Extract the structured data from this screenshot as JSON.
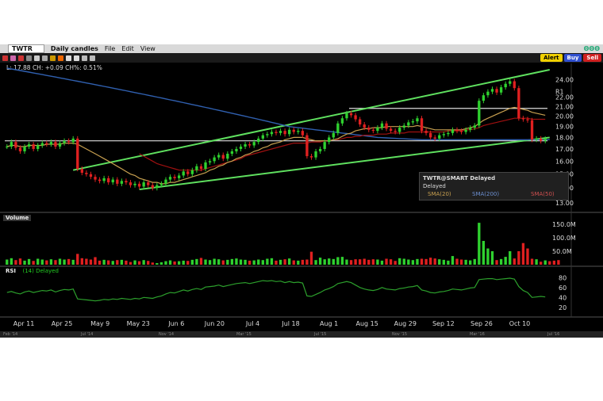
{
  "toolbar": {
    "symbol": "TWTR",
    "timeframe": "Daily candles",
    "menu": [
      "File",
      "Edit",
      "View"
    ],
    "alert": "Alert",
    "buy": "Buy",
    "sell": "Sell",
    "right_label": "ΘΘΘ"
  },
  "info_line": "L: 17.88 CH: +0.09 CH%: 0.51%",
  "legend": {
    "title": "TWTR@SMART Delayed",
    "status": "Delayed",
    "sma20": "SMA(20)",
    "sma200": "SMA(200)",
    "sma50": "SMA(50)",
    "colors": {
      "sma20": "#c8a050",
      "sma200": "#3060b0",
      "sma50": "#a01010"
    }
  },
  "panels": {
    "volume": "Volume",
    "rsi": "RSI",
    "rsi_series": "(14) Delayed"
  },
  "r1_label": "R1",
  "chart_data": {
    "type": "candlestick",
    "price_axis": {
      "ticks": [
        "24.00",
        "22.00",
        "21.00",
        "20.00",
        "19.00",
        "18.00",
        "17.00",
        "16.00",
        "15.00",
        "14.00",
        "13.00"
      ],
      "ylim": [
        12.6,
        25.4
      ],
      "scale": "log"
    },
    "volume_axis": {
      "ticks": [
        "150.0M",
        "100.0M",
        "50.0M"
      ],
      "ylim": [
        0,
        170
      ]
    },
    "rsi_axis": {
      "ticks": [
        "80",
        "60",
        "40",
        "20"
      ],
      "ylim": [
        10,
        95
      ]
    },
    "x_ticks": [
      "Apr 11",
      "Apr 25",
      "May 9",
      "May 23",
      "Jun 6",
      "Jun 20",
      "Jul 4",
      "Jul 18",
      "Aug 1",
      "Aug 15",
      "Aug 29",
      "Sep 12",
      "Sep 26",
      "Oct 10"
    ],
    "overview_ticks": [
      "Feb '14",
      "Jul '14",
      "Nov '14",
      "Mar '15",
      "Jul '15",
      "Nov '15",
      "Mar '16",
      "Jul '16"
    ],
    "closes": [
      17.2,
      17.6,
      17.1,
      16.8,
      17.2,
      17.4,
      17.0,
      17.3,
      17.5,
      17.4,
      17.6,
      17.2,
      17.5,
      17.7,
      17.6,
      17.9,
      15.4,
      15.1,
      15.0,
      14.8,
      14.6,
      14.5,
      14.7,
      14.4,
      14.6,
      14.3,
      14.5,
      14.4,
      14.2,
      14.3,
      14.1,
      14.4,
      14.2,
      14.0,
      14.2,
      14.3,
      14.6,
      14.8,
      14.7,
      14.9,
      15.2,
      15.0,
      15.3,
      15.6,
      15.4,
      15.9,
      16.0,
      16.3,
      16.5,
      16.2,
      16.6,
      16.8,
      17.0,
      17.2,
      17.4,
      17.3,
      17.6,
      17.9,
      18.2,
      18.3,
      18.5,
      18.4,
      18.6,
      18.3,
      18.7,
      18.5,
      18.6,
      18.2,
      16.4,
      16.3,
      16.8,
      17.0,
      17.6,
      18.0,
      18.4,
      19.3,
      19.8,
      20.3,
      20.1,
      19.7,
      19.2,
      18.9,
      18.7,
      18.6,
      18.9,
      19.3,
      18.8,
      18.6,
      18.5,
      18.9,
      19.1,
      19.4,
      19.5,
      19.8,
      18.6,
      18.4,
      18.0,
      17.9,
      18.2,
      18.3,
      18.4,
      18.7,
      18.6,
      18.5,
      18.7,
      18.9,
      19.1,
      21.6,
      22.2,
      22.6,
      22.9,
      22.5,
      23.1,
      23.5,
      23.8,
      23.0,
      19.8,
      19.7,
      19.6,
      17.8,
      17.9,
      17.7,
      17.88
    ],
    "volume": [
      19,
      24,
      17,
      23,
      15,
      21,
      14,
      22,
      19,
      16,
      20,
      17,
      22,
      19,
      21,
      18,
      40,
      24,
      22,
      19,
      28,
      15,
      18,
      16,
      14,
      17,
      18,
      15,
      10,
      16,
      13,
      17,
      14,
      8,
      6,
      9,
      13,
      16,
      12,
      13,
      15,
      14,
      18,
      21,
      25,
      19,
      17,
      22,
      20,
      16,
      18,
      21,
      23,
      19,
      18,
      15,
      16,
      19,
      17,
      22,
      24,
      15,
      18,
      20,
      23,
      16,
      15,
      18,
      19,
      48,
      17,
      26,
      20,
      23,
      21,
      28,
      29,
      19,
      17,
      20,
      20,
      22,
      18,
      20,
      19,
      15,
      22,
      20,
      14,
      24,
      22,
      19,
      17,
      21,
      22,
      21,
      26,
      23,
      20,
      18,
      15,
      32,
      22,
      19,
      18,
      16,
      21,
      155,
      88,
      60,
      50,
      17,
      21,
      29,
      50,
      23,
      50,
      80,
      60,
      22,
      20,
      11,
      16,
      13,
      15,
      17
    ],
    "rsi": [
      50,
      52,
      49,
      47,
      51,
      53,
      50,
      52,
      54,
      53,
      55,
      51,
      54,
      56,
      55,
      57,
      37,
      36,
      35,
      34,
      33,
      34,
      36,
      35,
      37,
      36,
      38,
      37,
      36,
      38,
      37,
      40,
      39,
      38,
      41,
      43,
      47,
      50,
      49,
      52,
      55,
      53,
      56,
      58,
      56,
      61,
      62,
      63,
      65,
      62,
      64,
      66,
      68,
      69,
      70,
      68,
      70,
      72,
      74,
      73,
      74,
      72,
      73,
      70,
      72,
      70,
      71,
      69,
      43,
      42,
      46,
      50,
      55,
      58,
      62,
      68,
      70,
      72,
      70,
      65,
      60,
      57,
      55,
      54,
      56,
      60,
      57,
      56,
      55,
      58,
      59,
      61,
      62,
      64,
      55,
      53,
      50,
      49,
      51,
      52,
      54,
      57,
      56,
      55,
      57,
      59,
      60,
      76,
      77,
      78,
      78,
      76,
      77,
      78,
      79,
      77,
      62,
      54,
      50,
      40,
      41,
      42,
      41
    ],
    "sma20": [
      17.2,
      17.3,
      17.3,
      17.2,
      17.2,
      17.3,
      17.3,
      17.3,
      17.3,
      17.4,
      17.4,
      17.4,
      17.4,
      17.5,
      17.5,
      17.5,
      17.4,
      17.2,
      17.0,
      16.8,
      16.6,
      16.4,
      16.2,
      16.0,
      15.8,
      15.6,
      15.4,
      15.2,
      15.0,
      14.9,
      14.7,
      14.6,
      14.5,
      14.4,
      14.4,
      14.3,
      14.3,
      14.4,
      14.4,
      14.5,
      14.6,
      14.7,
      14.8,
      14.9,
      15.0,
      15.1,
      15.3,
      15.4,
      15.6,
      15.7,
      15.9,
      16.0,
      16.2,
      16.3,
      16.5,
      16.6,
      16.8,
      16.9,
      17.1,
      17.2,
      17.4,
      17.5,
      17.6,
      17.8,
      17.9,
      18.0,
      18.0,
      18.0,
      17.9,
      17.8,
      17.7,
      17.7,
      17.7,
      17.7,
      17.8,
      17.9,
      18.1,
      18.3,
      18.4,
      18.6,
      18.7,
      18.8,
      18.8,
      18.9,
      18.9,
      18.9,
      19.0,
      19.0,
      19.0,
      19.0,
      19.0,
      19.0,
      19.0,
      19.1,
      19.0,
      18.9,
      18.8,
      18.7,
      18.7,
      18.7,
      18.7,
      18.7,
      18.7,
      18.7,
      18.8,
      18.9,
      19.0,
      19.3,
      19.6,
      19.8,
      20.0,
      20.2,
      20.4,
      20.6,
      20.8,
      20.9,
      20.8,
      20.7,
      20.6,
      20.4,
      20.3,
      20.2,
      20.1
    ],
    "sma50": [
      null,
      null,
      null,
      null,
      null,
      null,
      null,
      null,
      null,
      null,
      null,
      null,
      null,
      null,
      null,
      null,
      null,
      null,
      null,
      null,
      null,
      null,
      null,
      null,
      null,
      null,
      null,
      null,
      null,
      null,
      16.6,
      16.4,
      16.2,
      16.0,
      15.8,
      15.7,
      15.6,
      15.5,
      15.4,
      15.3,
      15.3,
      15.3,
      15.3,
      15.3,
      15.3,
      15.4,
      15.5,
      15.6,
      15.7,
      15.8,
      15.9,
      16.0,
      16.1,
      16.2,
      16.4,
      16.5,
      16.6,
      16.7,
      16.8,
      16.9,
      17.0,
      17.1,
      17.2,
      17.3,
      17.4,
      17.5,
      17.5,
      17.5,
      17.5,
      17.6,
      17.6,
      17.6,
      17.7,
      17.7,
      17.8,
      17.8,
      17.9,
      18.0,
      18.0,
      18.1,
      18.1,
      18.2,
      18.2,
      18.2,
      18.3,
      18.3,
      18.3,
      18.4,
      18.4,
      18.4,
      18.4,
      18.5,
      18.5,
      18.5,
      18.5,
      18.5,
      18.5,
      18.5,
      18.5,
      18.5,
      18.6,
      18.6,
      18.6,
      18.6,
      18.7,
      18.7,
      18.8,
      18.9,
      19.1,
      19.2,
      19.3,
      19.4,
      19.5,
      19.6,
      19.7,
      19.8,
      19.8,
      19.8,
      19.8,
      19.7,
      19.7,
      19.7,
      19.7
    ],
    "sma200": [
      25.4,
      25.3,
      25.2,
      25.1,
      25.0,
      24.9,
      24.8,
      24.7,
      24.6,
      24.5,
      24.4,
      24.3,
      24.2,
      24.1,
      24.0,
      23.9,
      23.8,
      23.7,
      23.6,
      23.5,
      23.4,
      23.3,
      23.2,
      23.1,
      23.0,
      22.9,
      22.8,
      22.7,
      22.6,
      22.5,
      22.4,
      22.3,
      22.2,
      22.1,
      22.0,
      21.9,
      21.8,
      21.7,
      21.6,
      21.5,
      21.4,
      21.3,
      21.2,
      21.1,
      21.0,
      20.9,
      20.8,
      20.7,
      20.6,
      20.5,
      20.4,
      20.3,
      20.2,
      20.1,
      20.0,
      19.9,
      19.8,
      19.7,
      19.6,
      19.5,
      19.4,
      19.3,
      19.2,
      19.1,
      19.0,
      18.95,
      18.9,
      18.85,
      18.8,
      18.75,
      18.7,
      18.65,
      18.6,
      18.55,
      18.5,
      18.45,
      18.4,
      18.35,
      18.3,
      18.25,
      18.2,
      18.15,
      18.1,
      18.05,
      18.0,
      17.98,
      17.96,
      17.94,
      17.92,
      17.9,
      17.88,
      17.86,
      17.84,
      17.82,
      17.8,
      17.8,
      17.8,
      17.8,
      17.8,
      17.8,
      17.8,
      17.8,
      17.8,
      17.8,
      17.8,
      17.8,
      17.8,
      17.8,
      17.8,
      17.8,
      17.8,
      17.8,
      17.8,
      17.8,
      17.8,
      17.8,
      17.8,
      17.8,
      17.8,
      17.8,
      17.8,
      17.8,
      17.8,
      17.8
    ],
    "support_resistance": {
      "r1": 20.8,
      "s1": 17.7
    },
    "channel_upper": [
      [
        15,
        15.3
      ],
      [
        123,
        25.2
      ]
    ],
    "channel_lower": [
      [
        30,
        13.9
      ],
      [
        123,
        18.0
      ]
    ]
  }
}
